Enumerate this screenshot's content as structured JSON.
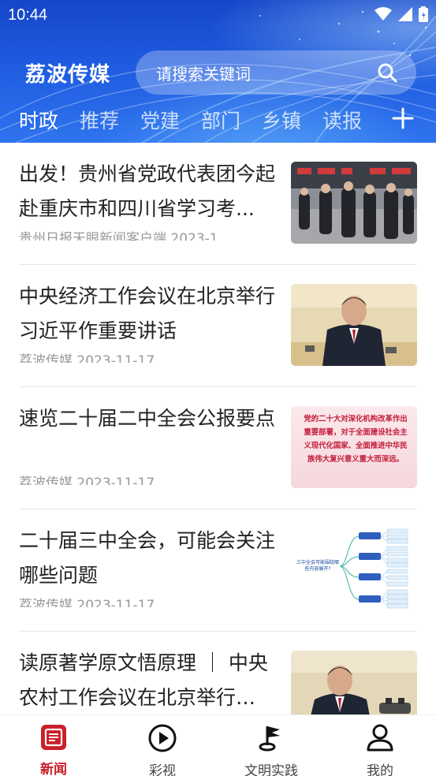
{
  "status": {
    "time": "10:44"
  },
  "header": {
    "brand": "荔波传媒",
    "search_placeholder": "请搜索关键词",
    "tabs": [
      "时政",
      "推荐",
      "党建",
      "部门",
      "乡镇",
      "读报"
    ]
  },
  "news": [
    {
      "title": "出发！贵州省党政代表团今起赴重庆市和四川省学习考...",
      "meta": "贵州日报天眼新闻客户端  2023-1"
    },
    {
      "title": "中央经济工作会议在北京举行习近平作重要讲话",
      "meta": "荔波传媒  2023-11-17"
    },
    {
      "title": "速览二十届二中全会公报要点",
      "meta": "荔波传媒  2023-11-17",
      "thumb_text": "党的二十大对深化机构改革作出重要部署，对于全面建设社会主义现代化国家、全面推进中华民族伟大复兴意义重大而深远。"
    },
    {
      "title": "二十届三中全会，可能会关注哪些问题",
      "meta": "荔波传媒  2023-11-17",
      "thumb_text": "三中全会可能围绕哪些内容展开?"
    },
    {
      "title": "读原著学原文悟原理 ｜ 中央农村工作会议在北京举行 习...",
      "meta": ""
    }
  ],
  "bottom_nav": {
    "items": [
      {
        "label": "新闻",
        "icon": "news-icon",
        "active": true
      },
      {
        "label": "彩视",
        "icon": "play-icon",
        "active": false
      },
      {
        "label": "文明实践",
        "icon": "flag-icon",
        "active": false
      },
      {
        "label": "我的",
        "icon": "profile-icon",
        "active": false
      }
    ]
  },
  "colors": {
    "accent": "#c8202a",
    "header_blue": "#1e5be0"
  }
}
